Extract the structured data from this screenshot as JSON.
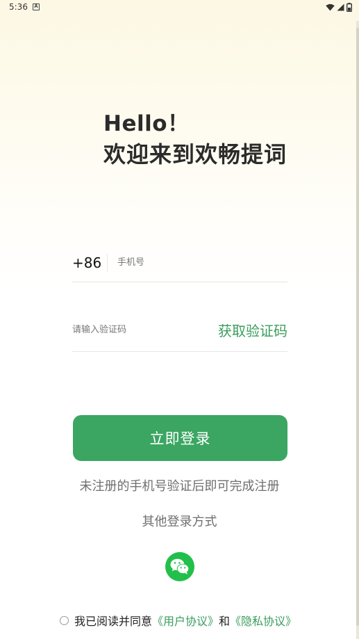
{
  "status_bar": {
    "time": "5:36",
    "notification_glyph": "A",
    "icons": [
      "wifi-icon",
      "signal-icon",
      "battery-icon"
    ]
  },
  "greeting": {
    "hello": "Hello！",
    "welcome": "欢迎来到欢畅提词"
  },
  "phone": {
    "country_code": "+86",
    "placeholder": "手机号"
  },
  "code": {
    "placeholder": "请输入验证码",
    "get_code_label": "获取验证码"
  },
  "login": {
    "button_label": "立即登录",
    "hint": "未注册的手机号验证后即可完成注册",
    "other_methods": "其他登录方式",
    "wechat_icon": "wechat-icon"
  },
  "agreement": {
    "prefix": "我已阅读并同意",
    "user_agreement": "《用户协议》",
    "and": "和",
    "privacy_policy": "《隐私协议》"
  },
  "colors": {
    "accent": "#3ba662",
    "link": "#3a9d5d",
    "wechat": "#22bf4a"
  }
}
